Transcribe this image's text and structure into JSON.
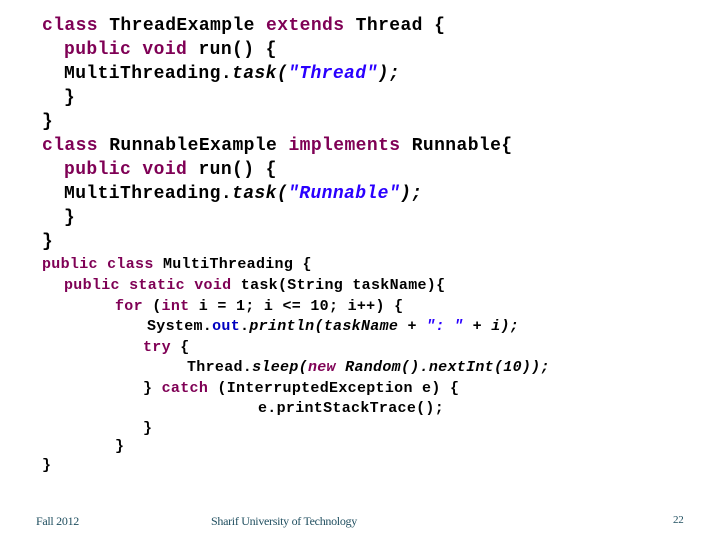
{
  "slide": {
    "code_lines": [
      {
        "indent": "",
        "parts": [
          {
            "t": "class ",
            "c": "kw"
          },
          {
            "t": "ThreadExample "
          },
          {
            "t": "extends ",
            "c": "kw"
          },
          {
            "t": "Thread {"
          }
        ]
      },
      {
        "indent": "  ",
        "parts": [
          {
            "t": "public ",
            "c": "kw"
          },
          {
            "t": "void ",
            "c": "kw"
          },
          {
            "t": "run() {"
          }
        ]
      },
      {
        "indent": "       ",
        "parts": [
          {
            "t": "MultiThreading."
          },
          {
            "t": "task",
            "c": "it"
          },
          {
            "t": "(",
            "c": "it"
          },
          {
            "t": "\"Thread\"",
            "c": "str"
          },
          {
            "t": ");",
            "c": "it"
          }
        ]
      },
      {
        "indent": "  ",
        "parts": [
          {
            "t": "}"
          }
        ]
      },
      {
        "indent": "",
        "parts": [
          {
            "t": "}"
          }
        ]
      },
      {
        "indent": "",
        "parts": [
          {
            "t": "class ",
            "c": "kw"
          },
          {
            "t": "RunnableExample "
          },
          {
            "t": "implements ",
            "c": "kw"
          },
          {
            "t": "Runnable{"
          }
        ]
      },
      {
        "indent": "  ",
        "parts": [
          {
            "t": "public ",
            "c": "kw"
          },
          {
            "t": "void ",
            "c": "kw"
          },
          {
            "t": "run() {"
          }
        ]
      },
      {
        "indent": "       ",
        "parts": [
          {
            "t": "MultiThreading."
          },
          {
            "t": "task",
            "c": "it"
          },
          {
            "t": "(",
            "c": "it"
          },
          {
            "t": "\"Runnable\"",
            "c": "str"
          },
          {
            "t": ");",
            "c": "it"
          }
        ]
      },
      {
        "indent": "  ",
        "parts": [
          {
            "t": "}"
          }
        ]
      },
      {
        "indent": "",
        "parts": [
          {
            "t": "}"
          }
        ]
      },
      {
        "indent": "",
        "parts": [
          {
            "t": "public ",
            "c": "kw"
          },
          {
            "t": "class ",
            "c": "kw"
          },
          {
            "t": "MultiThreading {"
          }
        ]
      },
      {
        "indent": "  ",
        "parts": [
          {
            "t": "public ",
            "c": "kw"
          },
          {
            "t": "static ",
            "c": "kw"
          },
          {
            "t": "void ",
            "c": "kw"
          },
          {
            "t": "task(String taskName){"
          }
        ]
      },
      {
        "indent": "",
        "parts": [
          {
            "t": "for ",
            "c": "kw"
          },
          {
            "t": "("
          },
          {
            "t": "int ",
            "c": "kw"
          },
          {
            "t": "i = 1; i <= 10; i++) {"
          }
        ]
      },
      {
        "indent": "",
        "parts": [
          {
            "t": "System."
          },
          {
            "t": "out",
            "c": "fld"
          },
          {
            "t": "."
          },
          {
            "t": "println(taskName + ",
            "c": "it"
          },
          {
            "t": "\": \"",
            "c": "str"
          },
          {
            "t": " + i);",
            "c": "it"
          }
        ]
      },
      {
        "indent": "",
        "parts": [
          {
            "t": "try ",
            "c": "kw"
          },
          {
            "t": "{"
          }
        ]
      },
      {
        "indent": "",
        "parts": [
          {
            "t": "Thread."
          },
          {
            "t": "sleep(",
            "c": "it"
          },
          {
            "t": "new ",
            "c": "kw it"
          },
          {
            "t": "Random().nextInt(10));",
            "c": "it"
          }
        ]
      },
      {
        "indent": "",
        "parts": [
          {
            "t": "} "
          },
          {
            "t": "catch ",
            "c": "kw"
          },
          {
            "t": "(InterruptedException e) {"
          }
        ]
      },
      {
        "indent": "",
        "parts": [
          {
            "t": "e.printStackTrace();"
          }
        ]
      },
      {
        "indent": "",
        "parts": [
          {
            "t": "}"
          }
        ]
      },
      {
        "indent": "",
        "parts": [
          {
            "t": "}"
          }
        ]
      },
      {
        "indent": "",
        "parts": [
          {
            "t": "}"
          }
        ]
      }
    ]
  },
  "footer": {
    "left": "Fall 2012",
    "center": "Sharif University of Technology",
    "page_number": "22"
  }
}
